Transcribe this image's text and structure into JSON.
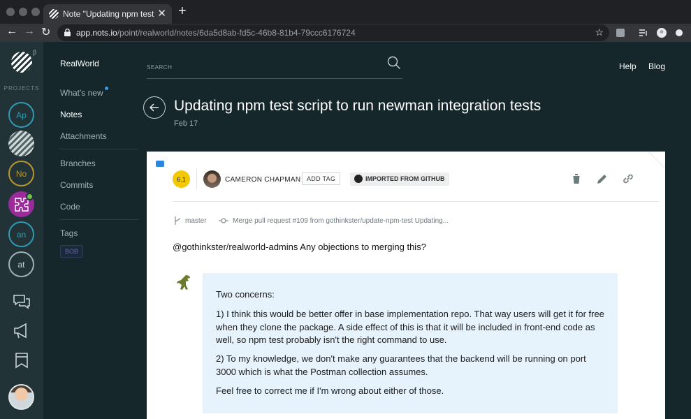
{
  "browser": {
    "tab_title": "Note \"Updating npm test script",
    "close_glyph": "✕",
    "new_tab_glyph": "+",
    "url_host": "app.nots.io",
    "url_path": "/point/realworld/notes/6da5d8ab-fd5c-46b8-81b4-79ccc6176724"
  },
  "rail": {
    "projects_label": "PROJECTS",
    "beta": "β",
    "projects": [
      {
        "label": "Ap",
        "color": "#2f9ab3"
      },
      {
        "label": "No",
        "color": "#b8962c"
      },
      {
        "label": "an",
        "color": "#2f9ab3"
      },
      {
        "label": "at",
        "color": "#9eb1b3"
      }
    ]
  },
  "sidenav": {
    "project": "RealWorld",
    "items": [
      "What's new",
      "Notes",
      "Attachments",
      "Branches",
      "Commits",
      "Code",
      "Tags"
    ],
    "tag": "BOB"
  },
  "header": {
    "search_placeholder": "SEARCH",
    "help": "Help",
    "blog": "Blog"
  },
  "note": {
    "title": "Updating npm test script to run newman integration tests",
    "date": "Feb 17",
    "score": "6.1",
    "author": "CAMERON CHAPMAN",
    "add_tag": "ADD TAG",
    "imported": "IMPORTED FROM GITHUB",
    "branch": "master",
    "commit": "Merge pull request #109 from gothinkster/update-npm-test Updating...",
    "body": "@gothinkster/realworld-admins Any objections to merging this?",
    "comment": [
      "Two concerns:",
      "1) I think this would be better offer in base implementation repo. That way users will get it for free when they clone the package. A side effect of this is that it will be included in front-end code as well, so npm test probably isn't the right command to use.",
      "2) To my knowledge, we don't make any guarantees that the backend will be running on port 3000 which is what the Postman collection assumes.",
      "Feel free to correct me if I'm wrong about either of those."
    ]
  },
  "colors": {
    "accent": "#3b9be8",
    "score": "#f2c800",
    "bubble": "#e6f3fc"
  }
}
